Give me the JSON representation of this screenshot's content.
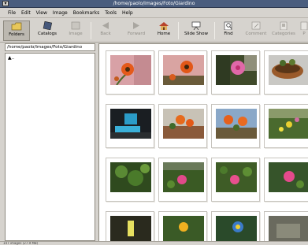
{
  "window": {
    "title": "/home/paolo/Images/Foto/Giardino",
    "menu_button": "▾"
  },
  "menubar": {
    "items": [
      "File",
      "Edit",
      "View",
      "Image",
      "Bookmarks",
      "Tools",
      "Help"
    ]
  },
  "toolbar": {
    "buttons": [
      {
        "label": "Folders",
        "icon": "folder-icon",
        "state": "active"
      },
      {
        "label": "Catalogs",
        "icon": "catalog-icon",
        "state": "normal"
      },
      {
        "label": "Image",
        "icon": "image-icon",
        "state": "disabled"
      },
      {
        "label": "Back",
        "icon": "back-arrow-icon",
        "state": "disabled"
      },
      {
        "label": "Forward",
        "icon": "forward-arrow-icon",
        "state": "disabled"
      },
      {
        "label": "Home",
        "icon": "home-icon",
        "state": "normal"
      },
      {
        "label": "Slide Show",
        "icon": "slideshow-icon",
        "state": "normal"
      },
      {
        "label": "Find",
        "icon": "find-icon",
        "state": "normal"
      },
      {
        "label": "Comment",
        "icon": "comment-icon",
        "state": "disabled"
      },
      {
        "label": "Categories",
        "icon": "categories-icon",
        "state": "disabled"
      },
      {
        "label": "P",
        "icon": "properties-icon",
        "state": "disabled"
      }
    ]
  },
  "location": {
    "path": "/home/paolo/Images/Foto/Giardino"
  },
  "folder_tree": {
    "items": [
      ".."
    ]
  },
  "thumbnails": [
    {
      "name": "orange-flower-pink-bg-1"
    },
    {
      "name": "orange-flower-pink-bg-2"
    },
    {
      "name": "pink-flower-dark-bg"
    },
    {
      "name": "plant-pot"
    },
    {
      "name": "blue-screen-scene"
    },
    {
      "name": "orange-flower-balcony"
    },
    {
      "name": "orange-flowers-sky"
    },
    {
      "name": "yellow-flowers-green"
    },
    {
      "name": "green-foliage"
    },
    {
      "name": "pink-flower-leaves-1"
    },
    {
      "name": "pink-flower-leaves-2"
    },
    {
      "name": "pink-flower-leaves-3"
    },
    {
      "name": "yellow-light"
    },
    {
      "name": "yellow-flower"
    },
    {
      "name": "blue-yellow-flower"
    },
    {
      "name": "garden-misc"
    }
  ],
  "status": {
    "text": "147 images (27.9 MB)"
  },
  "colors": {
    "titlebar": "#4a5d7e",
    "chrome": "#d6d3ce",
    "pane": "#ffffff"
  }
}
